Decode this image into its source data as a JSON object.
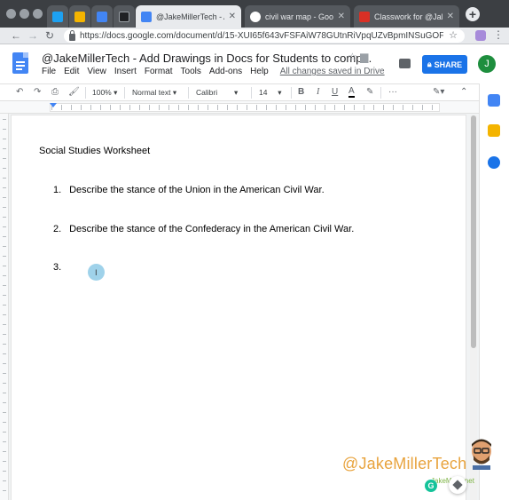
{
  "browser": {
    "tabs": [
      {
        "label": "",
        "icon": "twitter-icon",
        "color": "#1da1f2",
        "pinned": true
      },
      {
        "label": "",
        "icon": "keep-icon",
        "color": "#f4b400",
        "pinned": true
      },
      {
        "label": "",
        "icon": "calendar-icon",
        "color": "#4285f4",
        "pinned": true
      },
      {
        "label": "",
        "icon": "tab-icon",
        "color": "#3c4043",
        "pinned": true
      },
      {
        "label": "@JakeMillerTech - Add",
        "icon": "docs-icon",
        "color": "#4285f4",
        "pinned": false,
        "active": true
      },
      {
        "label": "civil war map - Google",
        "icon": "google-icon",
        "color": "#ea4335",
        "pinned": false
      },
      {
        "label": "Classwork for @JakeM",
        "icon": "classroom-icon",
        "color": "#d93025",
        "pinned": false
      }
    ],
    "new_tab": "+",
    "url": "https://docs.google.com/document/d/15-XUI65f643vFSFAiW78GUtnRiVpqUZvBpmINSuGOF0/e..."
  },
  "doc": {
    "title": "@JakeMillerTech - Add Drawings in Docs for Students to comp...",
    "menu": [
      "File",
      "Edit",
      "View",
      "Insert",
      "Format",
      "Tools",
      "Add-ons",
      "Help"
    ],
    "save_status": "All changes saved in Drive",
    "share_label": "SHARE",
    "avatar_initial": "J",
    "colors": {
      "accent": "#1a73e8",
      "docs_blue": "#4285f4",
      "avatar": "#1e8e3e"
    }
  },
  "toolbar": {
    "zoom": "100%",
    "style": "Normal text",
    "font": "Calibri",
    "size": "14",
    "bold": "B",
    "italic": "I",
    "underline": "U",
    "text_color": "A",
    "more": "···"
  },
  "content": {
    "heading": "Social Studies Worksheet",
    "questions": [
      {
        "num": "1.",
        "text": "Describe the stance of the Union in the American Civil War."
      },
      {
        "num": "2.",
        "text": "Describe the stance of the Confederacy in the American Civil War."
      },
      {
        "num": "3.",
        "text": ""
      }
    ]
  },
  "watermark": {
    "handle": "@JakeMillerTech",
    "site": "JakeMiller.net"
  }
}
